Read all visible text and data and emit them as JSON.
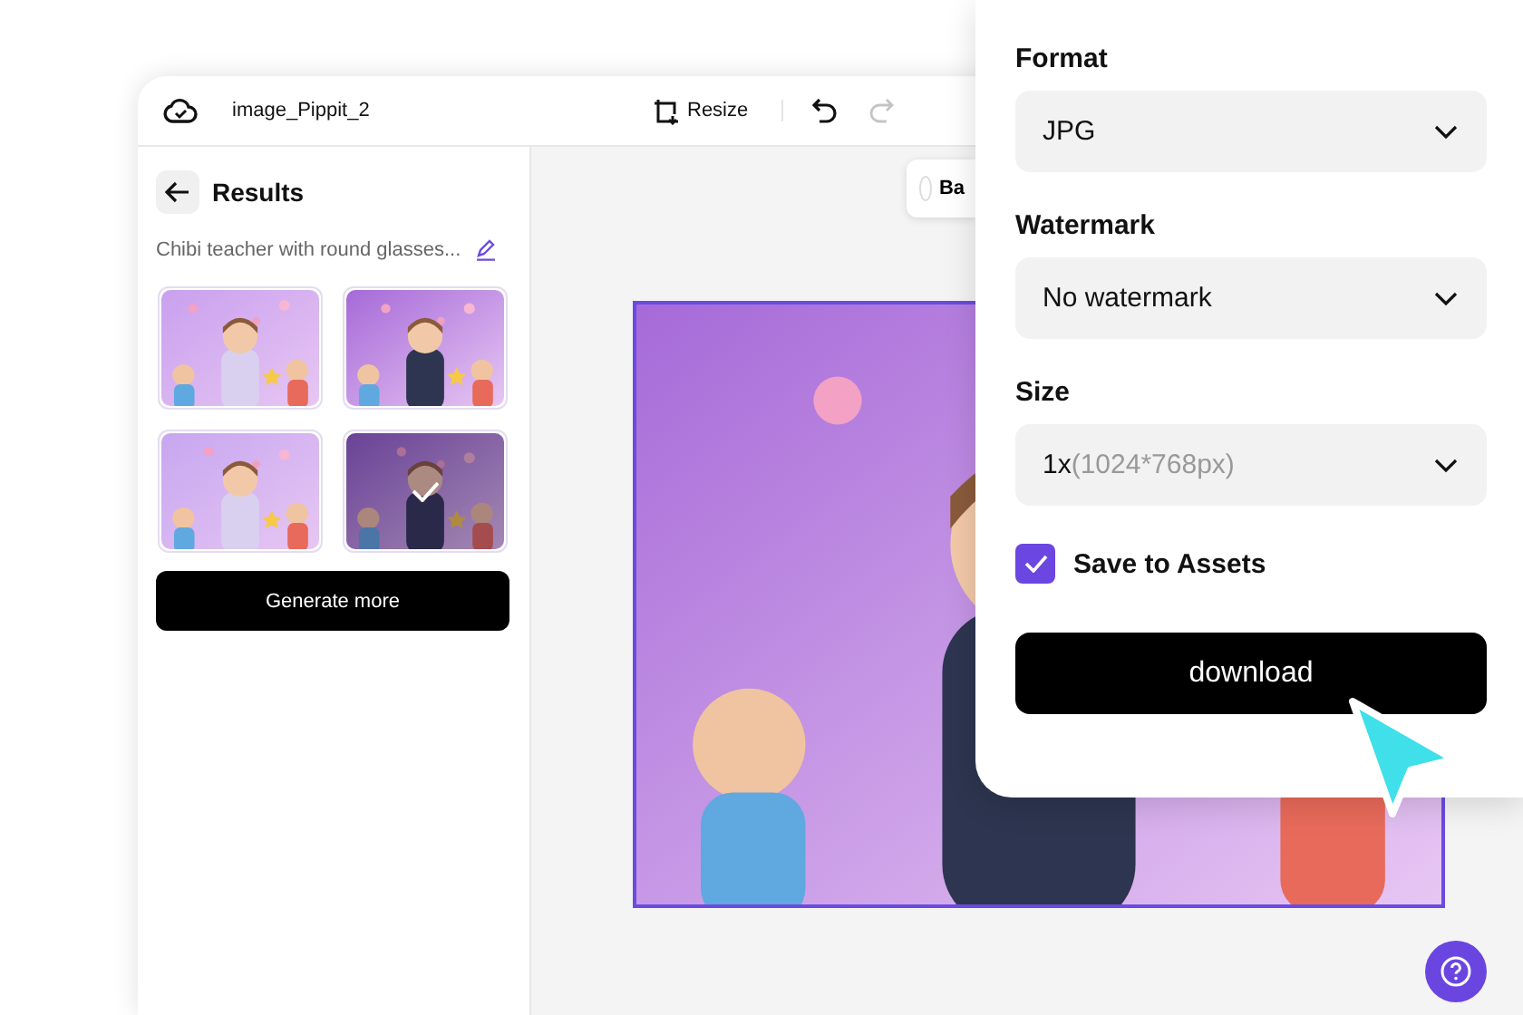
{
  "header": {
    "file_name": "image_Pippit_2",
    "resize_label": "Resize",
    "redo_disabled": true
  },
  "sidebar": {
    "title": "Results",
    "prompt": "Chibi teacher with round glasses...",
    "results": [
      {
        "selected": false
      },
      {
        "selected": false
      },
      {
        "selected": false
      },
      {
        "selected": true
      }
    ],
    "generate_button": "Generate more"
  },
  "canvas": {
    "chip_label": "Ba"
  },
  "export_panel": {
    "fields": [
      {
        "label": "Format",
        "value": "JPG"
      },
      {
        "label": "Watermark",
        "value": "No watermark"
      },
      {
        "label": "Size",
        "value": "1x",
        "detail": "(1024*768px)"
      }
    ],
    "save_to_assets": {
      "label": "Save to Assets",
      "checked": true
    },
    "download_button": "download"
  }
}
